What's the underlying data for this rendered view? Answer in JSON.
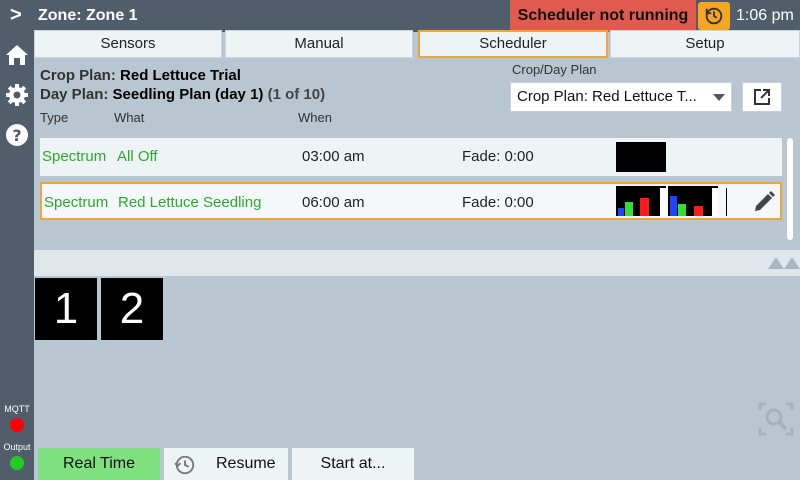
{
  "header": {
    "chevron": ">",
    "zone_title": "Zone: Zone 1",
    "scheduler_status": "Scheduler not running",
    "time": "1:06 pm",
    "status_color": "#e05a4e",
    "accent_color": "#f5a623"
  },
  "sidebar": {
    "icons": [
      "home-icon",
      "gear-icon",
      "help-icon"
    ],
    "mqtt_label": "MQTT",
    "mqtt_led_color": "#ff0000",
    "output_label": "Output",
    "output_led_color": "#22cc22"
  },
  "tabs": [
    {
      "label": "Sensors",
      "active": false
    },
    {
      "label": "Manual",
      "active": false
    },
    {
      "label": "Scheduler",
      "active": true
    },
    {
      "label": "Setup",
      "active": false
    }
  ],
  "plan": {
    "crop_label": "Crop Plan:",
    "crop_value": "Red Lettuce Trial",
    "day_label": "Day Plan:",
    "day_value": "Seedling Plan (day 1)",
    "day_count": "(1 of 10)",
    "selector_label": "Crop/Day Plan",
    "selector_value": "Crop Plan: Red Lettuce T..."
  },
  "table": {
    "headers": {
      "type": "Type",
      "what": "What",
      "when": "When"
    },
    "rows": [
      {
        "type": "Spectrum",
        "what": "All Off",
        "when": "03:00 am",
        "fade": "Fade: 0:00",
        "selected": false
      },
      {
        "type": "Spectrum",
        "what": "Red Lettuce Seedling",
        "when": "06:00 am",
        "fade": "Fade: 0:00",
        "selected": true
      }
    ]
  },
  "pages": [
    "1",
    "2"
  ],
  "bottom": {
    "realtime_label": "Real Time",
    "resume_label": "Resume",
    "startat_label": "Start at...",
    "realtime_color": "#7ee07e"
  }
}
